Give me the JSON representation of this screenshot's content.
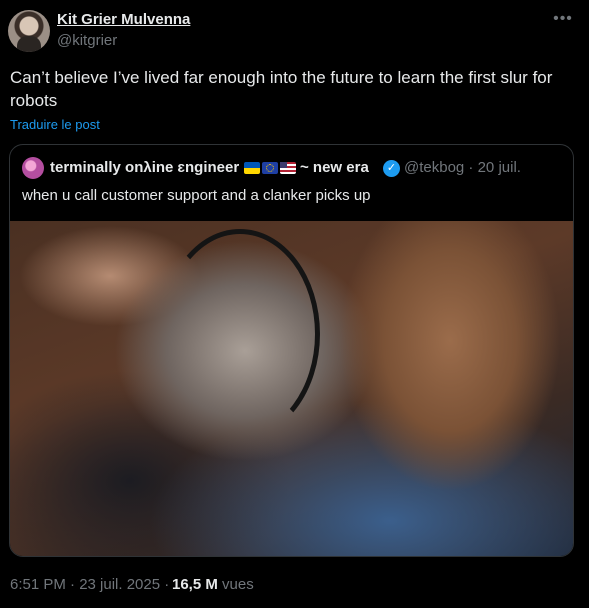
{
  "tweet": {
    "author_name": "Kit Grier Mulvenna",
    "author_handle": "@kitgrier",
    "text": "Can’t believe I’ve lived far enough into the future to learn the first slur for robots",
    "translate_label": "Traduire le post",
    "timestamp": "6:51 PM · 23 juil. 2025 · ",
    "views_count": "16,5 M",
    "views_label": "vues",
    "more_icon": "more-horizontal-icon"
  },
  "quoted": {
    "author_name": "terminally onλine ɛngineer",
    "name_suffix": "~ new era",
    "flags": [
      "ukraine-flag-icon",
      "eu-flag-icon",
      "us-flag-icon"
    ],
    "verified_icon": "verified-badge-icon",
    "handle_date": "@tekbog · 20 juil.",
    "text": "when u call customer support and a clanker picks up",
    "media_icon": "meme-photo"
  },
  "colors": {
    "background": "#000000",
    "text": "#e7e9ea",
    "muted": "#71767b",
    "link": "#1d9bf0",
    "border": "#2f3336"
  }
}
